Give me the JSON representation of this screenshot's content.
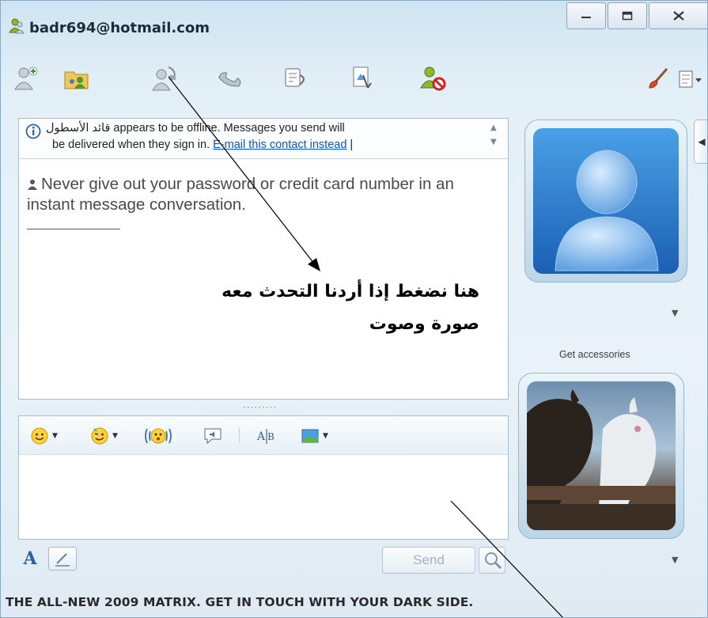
{
  "window": {
    "title": "badr694@hotmail.com",
    "buttons": [
      "minimize-icon",
      "maximize-icon",
      "close-icon"
    ]
  },
  "toolbar": {
    "left_icons": [
      "invite-contact-icon",
      "share-files-icon",
      "video-call-icon",
      "call-icon",
      "games-icon",
      "activities-icon",
      "block-contact-icon"
    ],
    "right_icons": [
      "theme-brush-icon",
      "menu-icon"
    ]
  },
  "conversation": {
    "info_line1_name": "قائد الأسطول",
    "info_line1_rest": " appears to be offline. Messages you send will",
    "info_line2_text": "be delivered when they sign in. ",
    "info_link": "E-mail this contact instead",
    "info_sep": " |",
    "warning": "Never give out your password or credit card number in an instant message conversation."
  },
  "annotation": {
    "line1": "هنا نضغط إذا أردنا التحدث معه",
    "line2": "صورة وصوت"
  },
  "compose": {
    "toolbar_icons": [
      "emoticon-icon",
      "wink-icon",
      "nudge-icon",
      "voice-clip-icon",
      "font-icon",
      "background-icon"
    ],
    "font_label": "A",
    "send_label": "Send",
    "send_enabled": false
  },
  "sidebar": {
    "get_accessories": "Get accessories",
    "contact_picture": "default-buddy-avatar",
    "my_picture": "horses-photo"
  },
  "ad_text": "THE ALL-NEW 2009 MATRIX. GET IN TOUCH WITH YOUR DARK SIDE.",
  "colors": {
    "link": "#0a55c4",
    "frame": "#bcd6e7",
    "window_bg": "#e3eff7"
  }
}
